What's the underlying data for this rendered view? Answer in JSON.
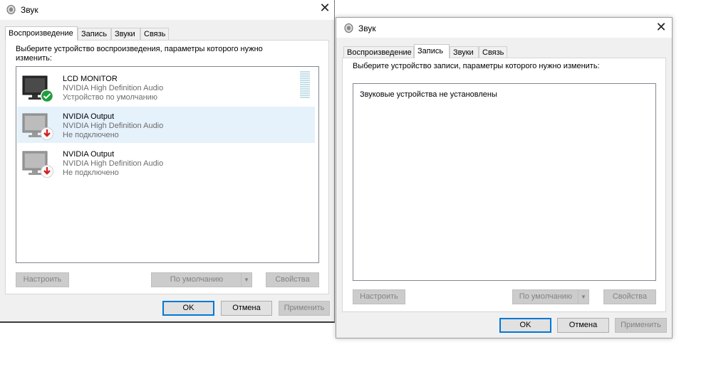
{
  "left_dialog": {
    "title": "Звук",
    "tabs": [
      {
        "label": "Воспроизведение",
        "active": true
      },
      {
        "label": "Запись",
        "active": false
      },
      {
        "label": "Звуки",
        "active": false
      },
      {
        "label": "Связь",
        "active": false
      }
    ],
    "prompt": "Выберите устройство воспроизведения, параметры которого нужно изменить:",
    "devices": [
      {
        "name": "LCD MONITOR",
        "driver": "NVIDIA High Definition Audio",
        "status": "Устройство по умолчанию",
        "badge": "check-icon",
        "selected": false
      },
      {
        "name": "NVIDIA Output",
        "driver": "NVIDIA High Definition Audio",
        "status": "Не подключено",
        "badge": "disconnected-arrow-icon",
        "selected": true
      },
      {
        "name": "NVIDIA Output",
        "driver": "NVIDIA High Definition Audio",
        "status": "Не подключено",
        "badge": "disconnected-arrow-icon",
        "selected": false
      }
    ],
    "buttons": {
      "configure": "Настроить",
      "default": "По умолчанию",
      "properties": "Свойства",
      "ok": "OK",
      "cancel": "Отмена",
      "apply": "Применить"
    }
  },
  "right_dialog": {
    "title": "Звук",
    "tabs": [
      {
        "label": "Воспроизведение",
        "active": false
      },
      {
        "label": "Запись",
        "active": true
      },
      {
        "label": "Звуки",
        "active": false
      },
      {
        "label": "Связь",
        "active": false
      }
    ],
    "prompt": "Выберите устройство записи, параметры которого нужно изменить:",
    "empty_message": "Звуковые устройства не установлены",
    "buttons": {
      "configure": "Настроить",
      "default": "По умолчанию",
      "properties": "Свойства",
      "ok": "OK",
      "cancel": "Отмена",
      "apply": "Применить"
    }
  },
  "colors": {
    "accent": "#0078d7",
    "selected_row": "#e5f1fb",
    "default_badge": "#1e9e3e",
    "disconnected_badge": "#d41f1f"
  }
}
